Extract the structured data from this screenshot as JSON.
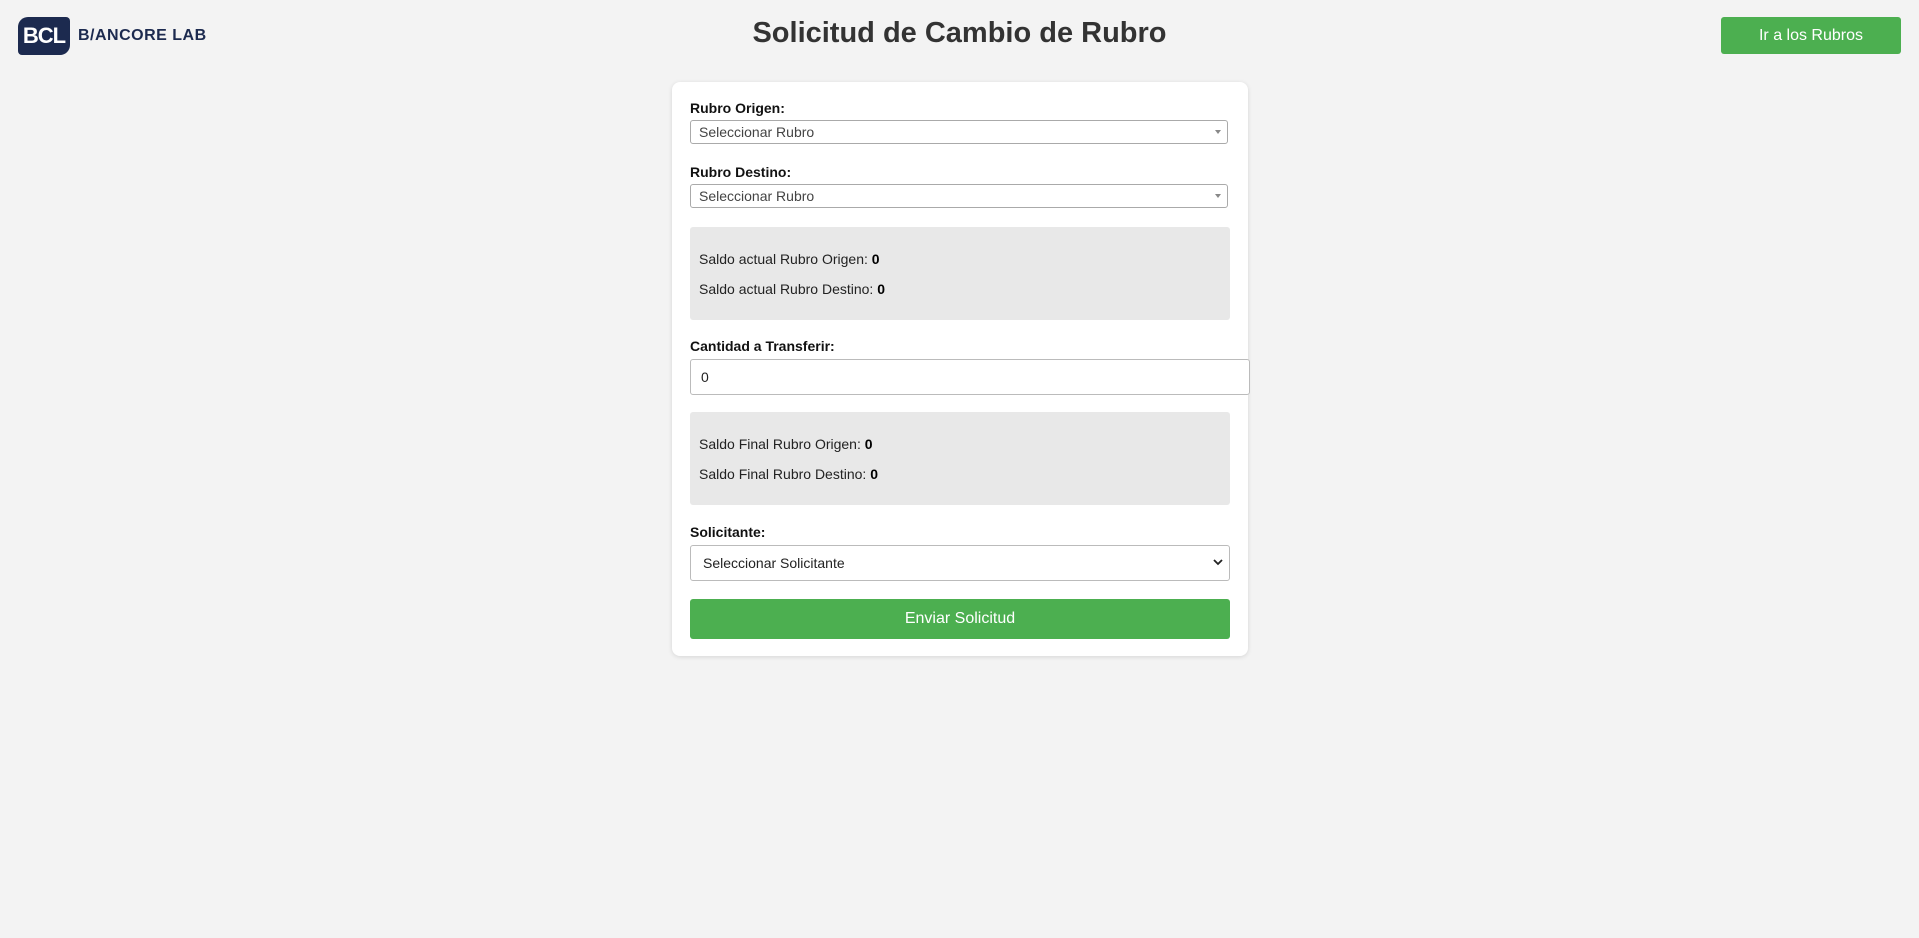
{
  "header": {
    "logo_mark": "BCL",
    "logo_text": "B/ANCORE LAB",
    "title": "Solicitud de Cambio de Rubro",
    "nav_button_label": "Ir a los Rubros"
  },
  "form": {
    "rubro_origen": {
      "label": "Rubro Origen:",
      "selected": "Seleccionar Rubro"
    },
    "rubro_destino": {
      "label": "Rubro Destino:",
      "selected": "Seleccionar Rubro"
    },
    "saldo_actual": {
      "origen_label": "Saldo actual Rubro Origen:",
      "origen_value": "0",
      "destino_label": "Saldo actual Rubro Destino:",
      "destino_value": "0"
    },
    "cantidad": {
      "label": "Cantidad a Transferir:",
      "value": "0"
    },
    "saldo_final": {
      "origen_label": "Saldo Final Rubro Origen:",
      "origen_value": "0",
      "destino_label": "Saldo Final Rubro Destino:",
      "destino_value": "0"
    },
    "solicitante": {
      "label": "Solicitante:",
      "selected": "Seleccionar Solicitante"
    },
    "submit_label": "Enviar Solicitud"
  },
  "colors": {
    "accent": "#4caf50",
    "brand": "#1c2a4f",
    "background": "#f3f3f3",
    "info_box": "#e8e8e8"
  }
}
